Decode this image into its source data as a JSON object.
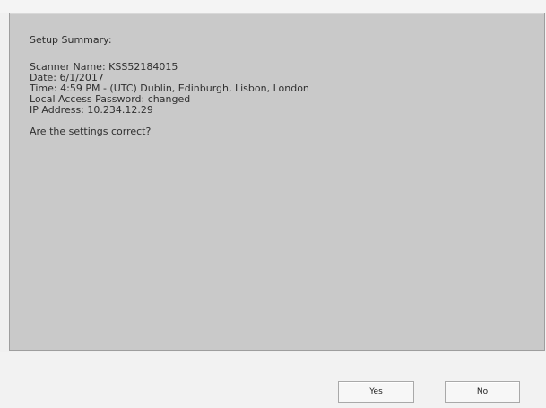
{
  "summary": {
    "title": "Setup Summary:",
    "scanner_name": "Scanner Name: KSS52184015",
    "date": "Date: 6/1/2017",
    "time": "Time: 4:59 PM - (UTC) Dublin, Edinburgh, Lisbon, London",
    "password": "Local Access Password: changed",
    "ip_address": "IP Address: 10.234.12.29",
    "question": "Are the settings correct?"
  },
  "actions": {
    "yes_label": "Yes",
    "no_label": "No"
  },
  "colors": {
    "panel_background": "#c9c9c9",
    "window_background": "#f2f2f2",
    "button_border": "#a9a9a9"
  }
}
